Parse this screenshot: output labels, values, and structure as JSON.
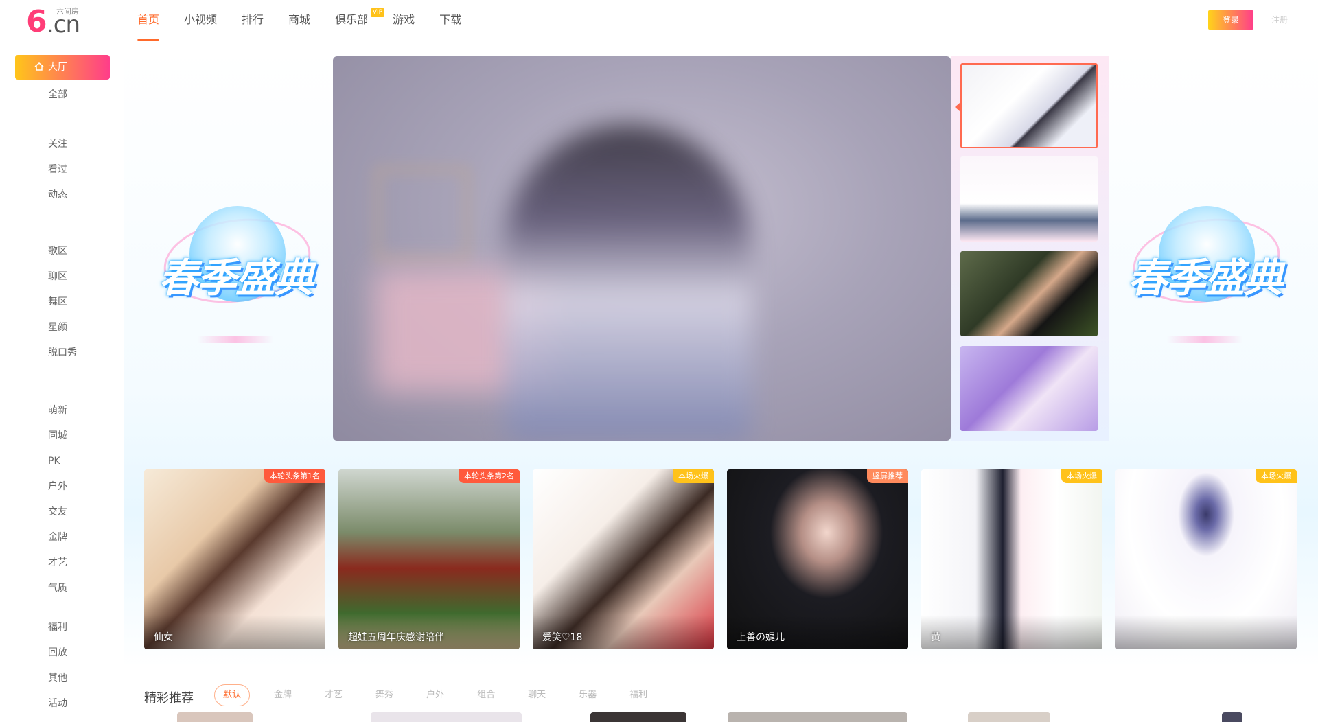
{
  "logo": {
    "mark": "6",
    "domain": ".cn",
    "small_text": "六间房"
  },
  "nav": {
    "items": [
      {
        "label": "首页",
        "active": true
      },
      {
        "label": "小视频"
      },
      {
        "label": "排行"
      },
      {
        "label": "商城"
      },
      {
        "label": "俱乐部",
        "badge": "VIP"
      },
      {
        "label": "游戏"
      },
      {
        "label": "下载"
      }
    ]
  },
  "header": {
    "login_label": "登录",
    "register_label": "注册"
  },
  "sidebar": {
    "hall_label": "大厅",
    "items": [
      "全部",
      "关注",
      "看过",
      "动态",
      "歌区",
      "聊区",
      "舞区",
      "星颜",
      "脱口秀",
      "萌新",
      "同城",
      "PK",
      "户外",
      "交友",
      "金牌",
      "才艺",
      "气质",
      "福利",
      "回放",
      "其他",
      "活动"
    ]
  },
  "hero": {
    "art_title": "春季盛典"
  },
  "featured": [
    {
      "tag": "本轮头条第1名",
      "name": "仙女",
      "tag_color": "#ff5a3c"
    },
    {
      "tag": "本轮头条第2名",
      "name": "超娃五周年庆感谢陪伴",
      "tag_color": "#ff5a3c"
    },
    {
      "tag": "本场火爆",
      "name": "爱笑♡18",
      "tag_color": "#ffc21a"
    },
    {
      "tag": "竖屏推荐",
      "name": "上善の娓儿",
      "tag_color": "#ff8a5c"
    },
    {
      "tag": "本场火爆",
      "name": "黄",
      "tag_color": "#ffc21a"
    },
    {
      "tag": "本场火爆",
      "name": "",
      "tag_color": "#ffc21a"
    }
  ],
  "recommend": {
    "title": "精彩推荐",
    "tabs": [
      {
        "label": "默认",
        "active": true
      },
      {
        "label": "金牌"
      },
      {
        "label": "才艺"
      },
      {
        "label": "舞秀"
      },
      {
        "label": "户外"
      },
      {
        "label": "组合"
      },
      {
        "label": "聊天"
      },
      {
        "label": "乐器"
      },
      {
        "label": "福利"
      }
    ]
  },
  "colors": {
    "accent": "#ff6a2b",
    "brand_pink": "#ff3d8a",
    "brand_yellow": "#ffc51a"
  }
}
